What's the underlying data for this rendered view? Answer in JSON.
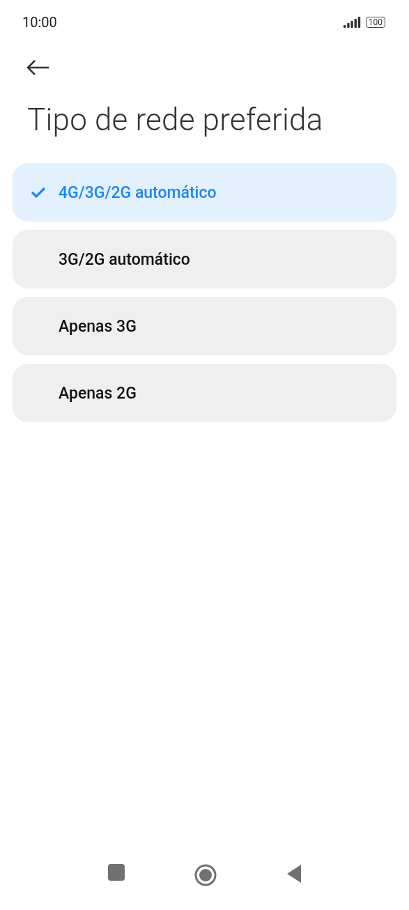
{
  "status_bar": {
    "time": "10:00",
    "battery": "100"
  },
  "title": "Tipo de rede preferida",
  "options": [
    {
      "label": "4G/3G/2G automático",
      "selected": true
    },
    {
      "label": "3G/2G automático",
      "selected": false
    },
    {
      "label": "Apenas 3G",
      "selected": false
    },
    {
      "label": "Apenas 2G",
      "selected": false
    }
  ]
}
